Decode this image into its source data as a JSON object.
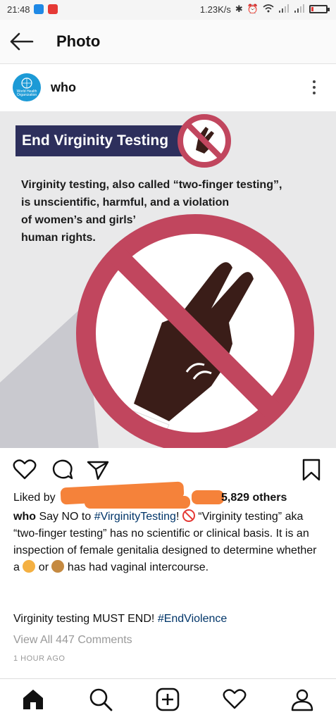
{
  "status_bar": {
    "time": "21:48",
    "network_speed": "1.23K/s",
    "icons": [
      "app-icon-blue",
      "app-icon-red",
      "bluetooth-icon",
      "alarm-icon",
      "wifi-icon",
      "signal-icon",
      "signal-icon",
      "battery-icon"
    ],
    "battery_level": 0.15
  },
  "header": {
    "title": "Photo",
    "back_icon": "arrow-left-icon"
  },
  "post": {
    "username": "who",
    "avatar_text": "World Health Organization",
    "more_icon": "more-vertical-icon",
    "image": {
      "banner_title": "End Virginity Testing",
      "body_text": "Virginity testing, also called “two-finger testing”,\nis unscientific, harmful, and a violation\nof women’s and girls’\nhuman rights.",
      "colors": {
        "banner": "#2d2f5c",
        "sign": "#c1465e",
        "hand": "#3a1d18",
        "background": "#e9e9ea"
      }
    },
    "actions": [
      "heart-icon",
      "comment-icon",
      "send-icon",
      "bookmark-icon"
    ],
    "likes": {
      "prefix": "Liked by",
      "suffix": "5,829 others"
    },
    "caption": {
      "username": "who",
      "part1": "Say NO to",
      "tag1": "#VirginityTesting",
      "part2": "! ",
      "part3": " “Virginity testing” aka “two-finger testing” has no scientific or clinical basis. It is an inspection of female genitalia designed to determine whether a ",
      "part4": " or ",
      "part5": " has had vaginal intercourse.",
      "line2": "Virginity testing MUST END!",
      "tag2": "#EndViolence"
    },
    "view_comments": "View All 447 Comments",
    "time_ago": "1 HOUR AGO"
  },
  "bottom_nav": [
    "home-icon",
    "search-icon",
    "add-post-icon",
    "activity-heart-icon",
    "profile-icon"
  ]
}
